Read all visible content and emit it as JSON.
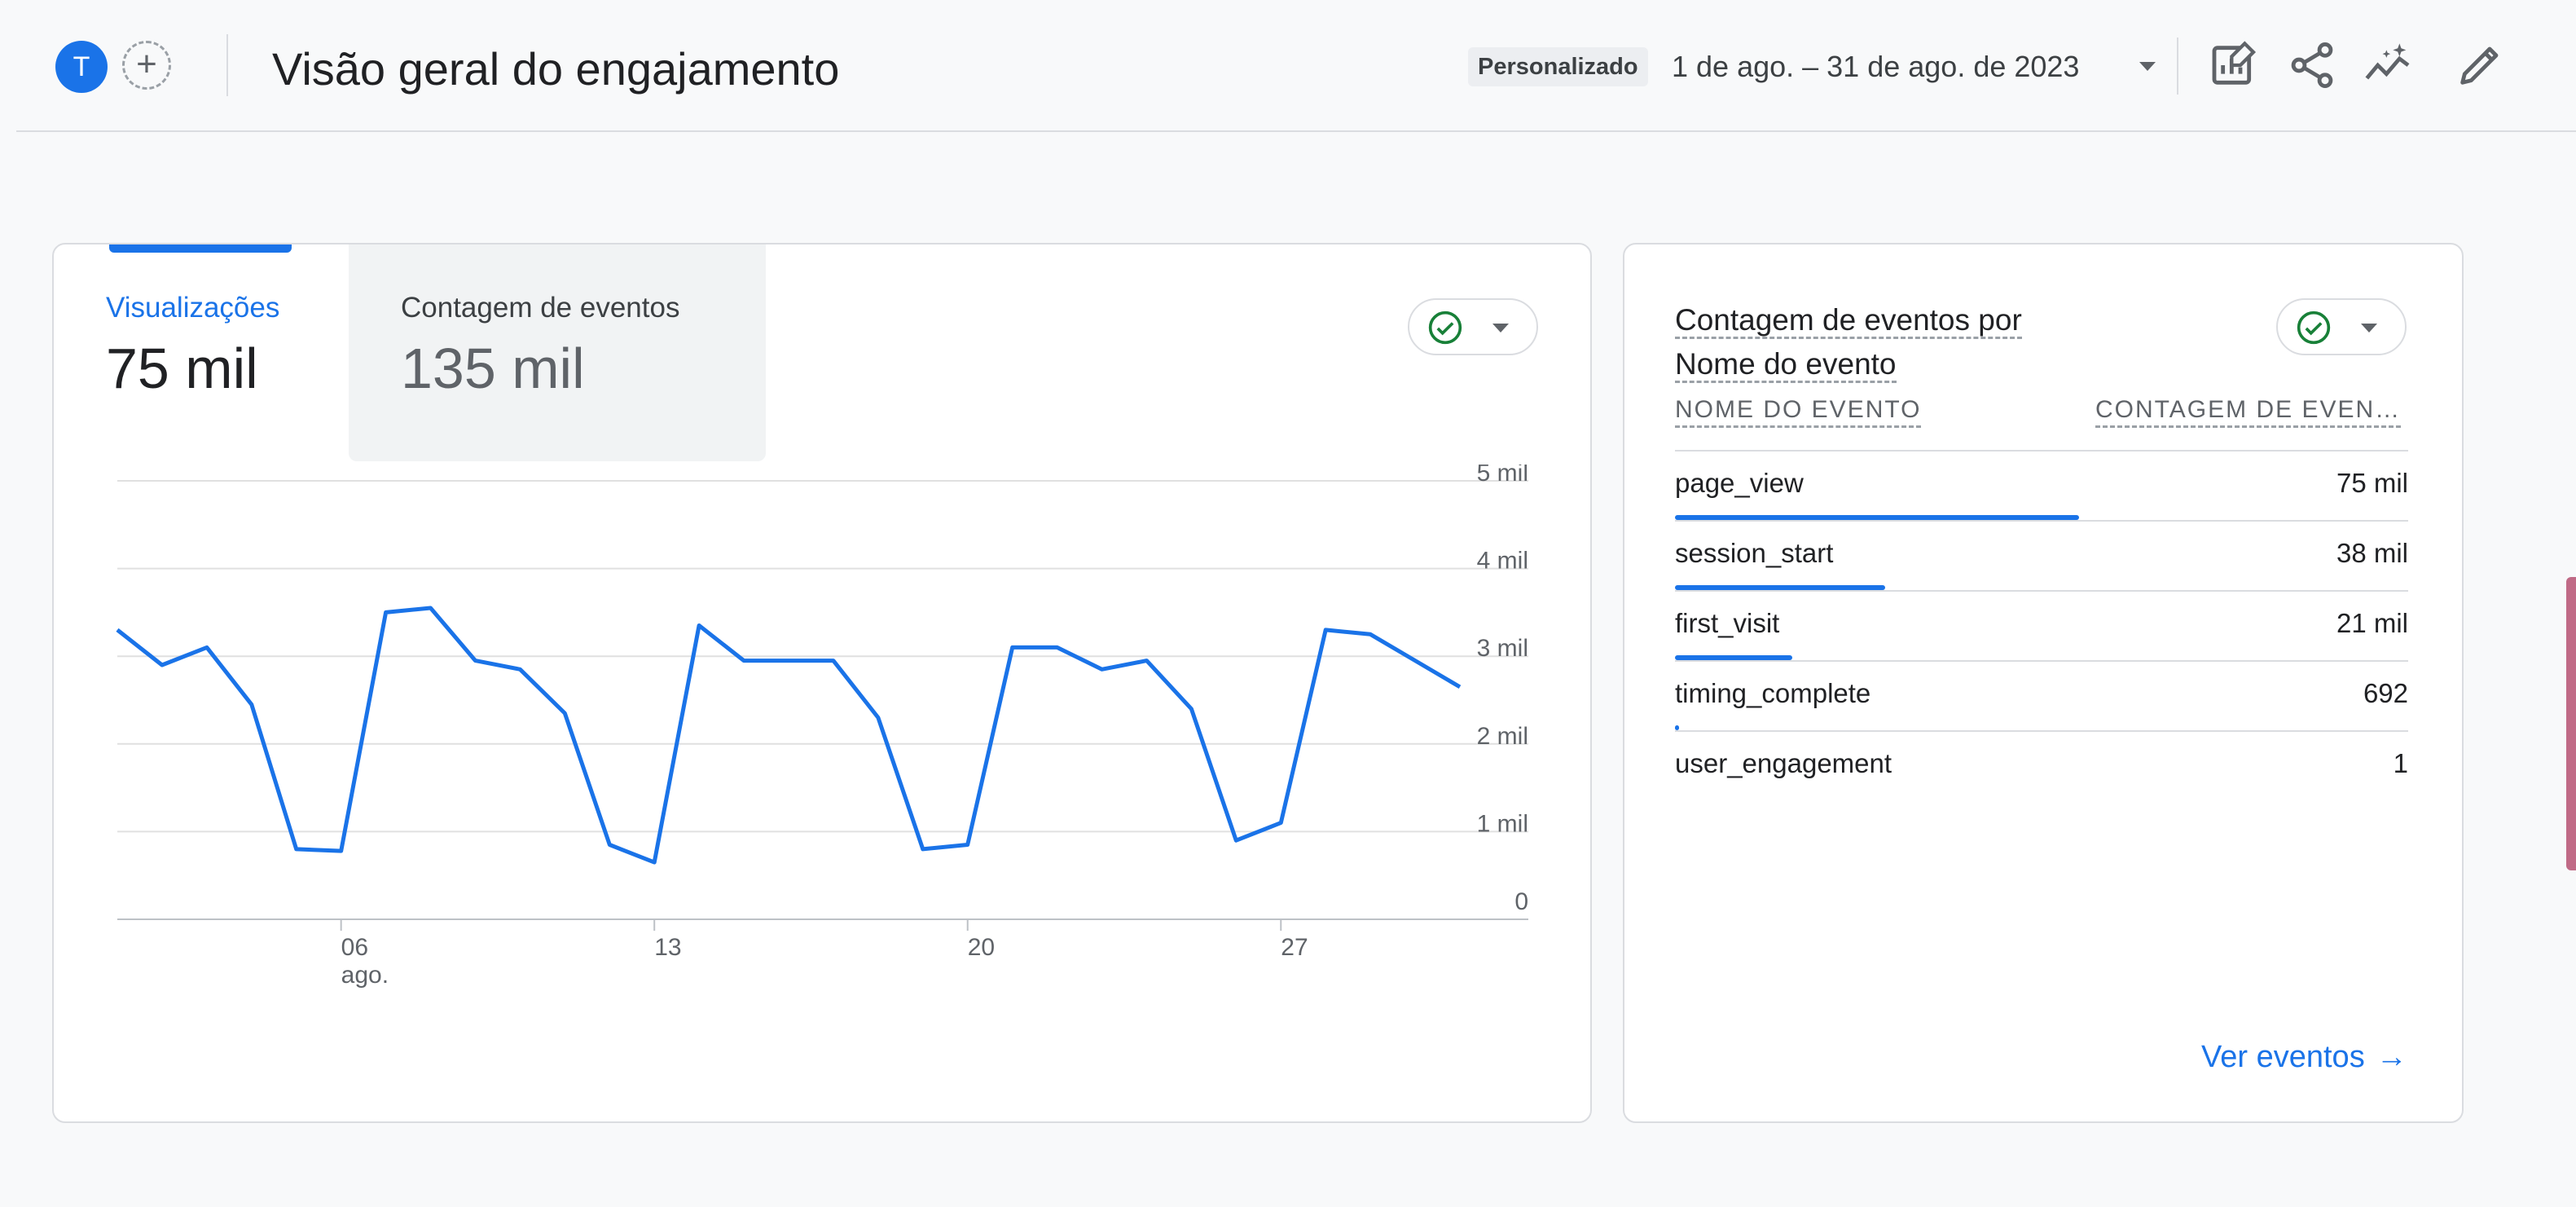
{
  "header": {
    "avatar_letter": "T",
    "add_label": "+",
    "title": "Visão geral do engajamento",
    "range_type": "Personalizado",
    "date_range": "1 de ago. – 31 de ago. de 2023",
    "icons": [
      "edit-report-icon",
      "share-icon",
      "insights-icon",
      "pencil-icon"
    ]
  },
  "overview_card": {
    "tabs": [
      {
        "label": "Visualizações",
        "value": "75 mil",
        "active": true
      },
      {
        "label": "Contagem de eventos",
        "value": "135 mil",
        "active": false
      }
    ],
    "status_icon": "check-circle-icon"
  },
  "chart_data": {
    "type": "line",
    "x": [
      1,
      2,
      3,
      4,
      5,
      6,
      7,
      8,
      9,
      10,
      11,
      12,
      13,
      14,
      15,
      16,
      17,
      18,
      19,
      20,
      21,
      22,
      23,
      24,
      25,
      26,
      27,
      28,
      29,
      30,
      31
    ],
    "series": [
      {
        "values": [
          3300,
          2900,
          3100,
          2450,
          800,
          780,
          3500,
          3550,
          2950,
          2850,
          2350,
          850,
          650,
          3350,
          2950,
          2950,
          2950,
          2300,
          800,
          850,
          3100,
          3100,
          2850,
          2950,
          2400,
          900,
          1100,
          3300,
          3250,
          2950,
          2650
        ]
      }
    ],
    "xticks": [
      {
        "x": 6,
        "label": "06",
        "sublabel": "ago."
      },
      {
        "x": 13,
        "label": "13",
        "sublabel": ""
      },
      {
        "x": 20,
        "label": "20",
        "sublabel": ""
      },
      {
        "x": 27,
        "label": "27",
        "sublabel": ""
      }
    ],
    "yticks": [
      {
        "value": 0,
        "label": "0"
      },
      {
        "value": 1000,
        "label": "1 mil"
      },
      {
        "value": 2000,
        "label": "2 mil"
      },
      {
        "value": 3000,
        "label": "3 mil"
      },
      {
        "value": 4000,
        "label": "4 mil"
      },
      {
        "value": 5000,
        "label": "5 mil"
      }
    ],
    "ylim": [
      0,
      5000
    ],
    "xlim": [
      1,
      31
    ],
    "grid": true,
    "color": "#1a73e8"
  },
  "events_card": {
    "title_part1": "Contagem de eventos por",
    "title_part2": "Nome do evento",
    "col_name": "NOME DO EVENTO",
    "col_count": "CONTAGEM DE EVEN…",
    "rows": [
      {
        "name": "page_view",
        "count": "75 mil",
        "share": 1.0
      },
      {
        "name": "session_start",
        "count": "38 mil",
        "share": 0.52
      },
      {
        "name": "first_visit",
        "count": "21 mil",
        "share": 0.29
      },
      {
        "name": "timing_complete",
        "count": "692",
        "share": 0.01
      },
      {
        "name": "user_engagement",
        "count": "1",
        "share": 0.0
      }
    ],
    "see_events": "Ver eventos",
    "status_icon": "check-circle-icon"
  },
  "colors": {
    "accent": "#1a73e8",
    "success": "#188038",
    "border": "#dadce0"
  }
}
